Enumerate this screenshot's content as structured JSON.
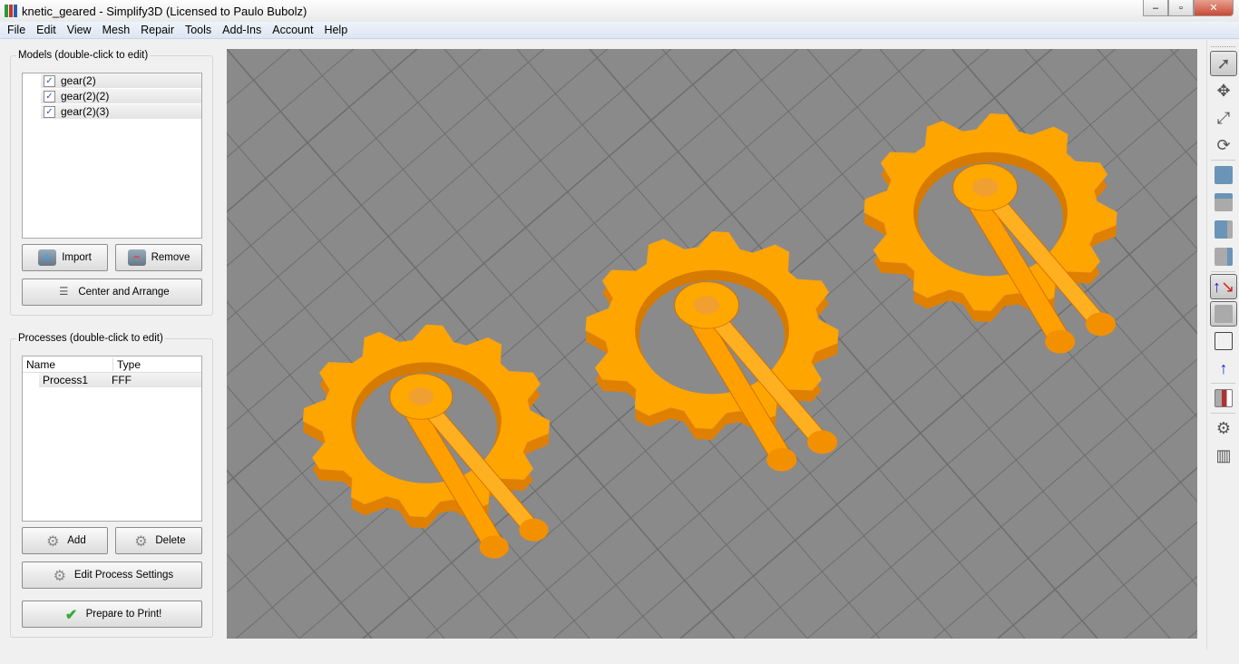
{
  "window": {
    "title": "knetic_geared - Simplify3D (Licensed to Paulo Bubolz)",
    "minimize": "–",
    "maximize": "▫",
    "close": "✕"
  },
  "menu": [
    "File",
    "Edit",
    "View",
    "Mesh",
    "Repair",
    "Tools",
    "Add-Ins",
    "Account",
    "Help"
  ],
  "models": {
    "label": "Models (double-click to edit)",
    "items": [
      {
        "name": "gear(2)",
        "checked": true
      },
      {
        "name": "gear(2)(2)",
        "checked": true
      },
      {
        "name": "gear(2)(3)",
        "checked": true
      }
    ],
    "import": "Import",
    "remove": "Remove",
    "center": "Center and Arrange"
  },
  "processes": {
    "label": "Processes (double-click to edit)",
    "columns": [
      "Name",
      "Type"
    ],
    "rows": [
      {
        "name": "Process1",
        "type": "FFF"
      }
    ],
    "add": "Add",
    "delete": "Delete",
    "edit": "Edit Process Settings",
    "prepare": "Prepare to Print!"
  },
  "colors": {
    "model": "#ffa500",
    "bed": "#8a8a8a",
    "grid": "#6e6e6e"
  },
  "toolbar_icons": [
    "select-icon",
    "move-icon",
    "scale-icon",
    "rotate-icon",
    "view-iso-icon",
    "view-front-icon",
    "view-top-icon",
    "view-side-icon",
    "axes-icon",
    "solid-view-icon",
    "wireframe-icon",
    "normal-icon",
    "cross-section-icon",
    "settings-gear-icon",
    "supports-icon"
  ]
}
